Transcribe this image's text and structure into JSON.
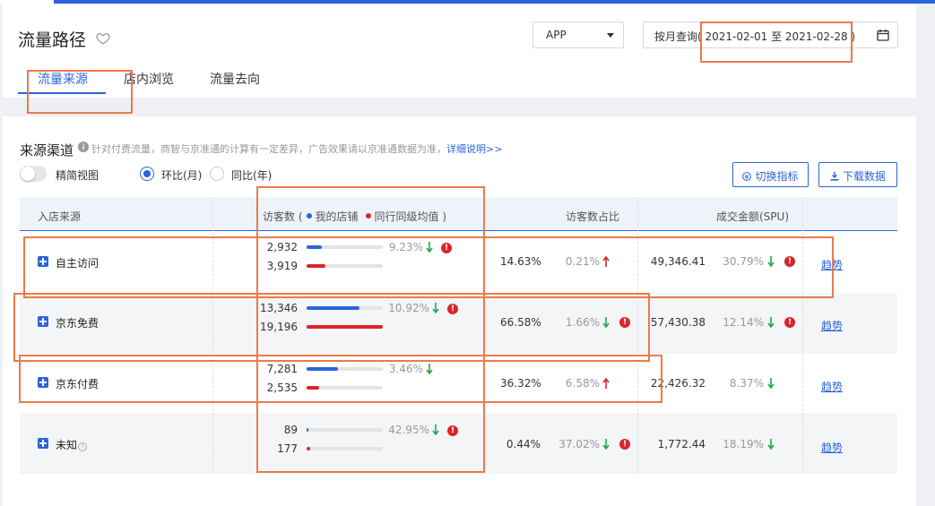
{
  "page": {
    "title": "流量路径",
    "platform_select": "APP",
    "date_range_label": "按月查询",
    "date_range_value": "( 2021-02-01 至 2021-02-28 )",
    "tabs": [
      {
        "label": "流量来源",
        "active": true
      },
      {
        "label": "店内浏览",
        "active": false
      },
      {
        "label": "流量去向",
        "active": false
      }
    ]
  },
  "section": {
    "title": "来源渠道",
    "note": "针对付费流量，商智与京准通的计算有一定差异，广告效果请以京准通数据为准，",
    "link": "详细说明>>",
    "toggle_label": "精简视图",
    "radio_mom": "环比(月)",
    "radio_yoy": "同比(年)",
    "btn_switch": "切换指标",
    "btn_download": "下载数据"
  },
  "table": {
    "headers": {
      "source": "入店来源",
      "visitors": "访客数 (",
      "legend_mine": "我的店铺",
      "legend_peer": "同行同级均值 )",
      "share": "访客数占比",
      "gmv": "成交金额(SPU)"
    },
    "rows": [
      {
        "name": "自主访问",
        "help": false,
        "mine": "2,932",
        "peer": "3,919",
        "mine_frac": 0.2,
        "peer_frac": 0.25,
        "visitor_change": "9.23%",
        "visitor_dir": "down",
        "visitor_warn": true,
        "share": "14.63%",
        "share_change": "0.21%",
        "share_dir": "up",
        "share_warn": false,
        "gmv": "49,346.41",
        "gmv_change": "30.79%",
        "gmv_dir": "down",
        "gmv_warn": true,
        "trend": "趋势"
      },
      {
        "name": "京东免费",
        "help": false,
        "mine": "13,346",
        "peer": "19,196",
        "mine_frac": 0.7,
        "peer_frac": 1.0,
        "visitor_change": "10.92%",
        "visitor_dir": "down",
        "visitor_warn": true,
        "share": "66.58%",
        "share_change": "1.66%",
        "share_dir": "down",
        "share_warn": true,
        "gmv": "57,430.38",
        "gmv_change": "12.14%",
        "gmv_dir": "down",
        "gmv_warn": true,
        "trend": "趋势"
      },
      {
        "name": "京东付费",
        "help": false,
        "mine": "7,281",
        "peer": "2,535",
        "mine_frac": 0.41,
        "peer_frac": 0.17,
        "visitor_change": "3.46%",
        "visitor_dir": "down",
        "visitor_warn": false,
        "share": "36.32%",
        "share_change": "6.58%",
        "share_dir": "up",
        "share_warn": false,
        "gmv": "22,426.32",
        "gmv_change": "8.37%",
        "gmv_dir": "down",
        "gmv_warn": false,
        "trend": "趋势"
      },
      {
        "name": "未知",
        "help": true,
        "mine": "89",
        "peer": "177",
        "mine_frac": 0.02,
        "peer_frac": 0.05,
        "visitor_change": "42.95%",
        "visitor_dir": "down",
        "visitor_warn": true,
        "share": "0.44%",
        "share_change": "37.02%",
        "share_dir": "down",
        "share_warn": true,
        "gmv": "1,772.44",
        "gmv_change": "18.19%",
        "gmv_dir": "down",
        "gmv_warn": false,
        "trend": "趋势"
      }
    ]
  },
  "colors": {
    "accent": "#2b64d9",
    "mine_bar": "#2b64d9",
    "peer_bar": "#d9252b",
    "up": "#d9252b",
    "down": "#1aab4c",
    "annotation": "#ec7a4a"
  }
}
